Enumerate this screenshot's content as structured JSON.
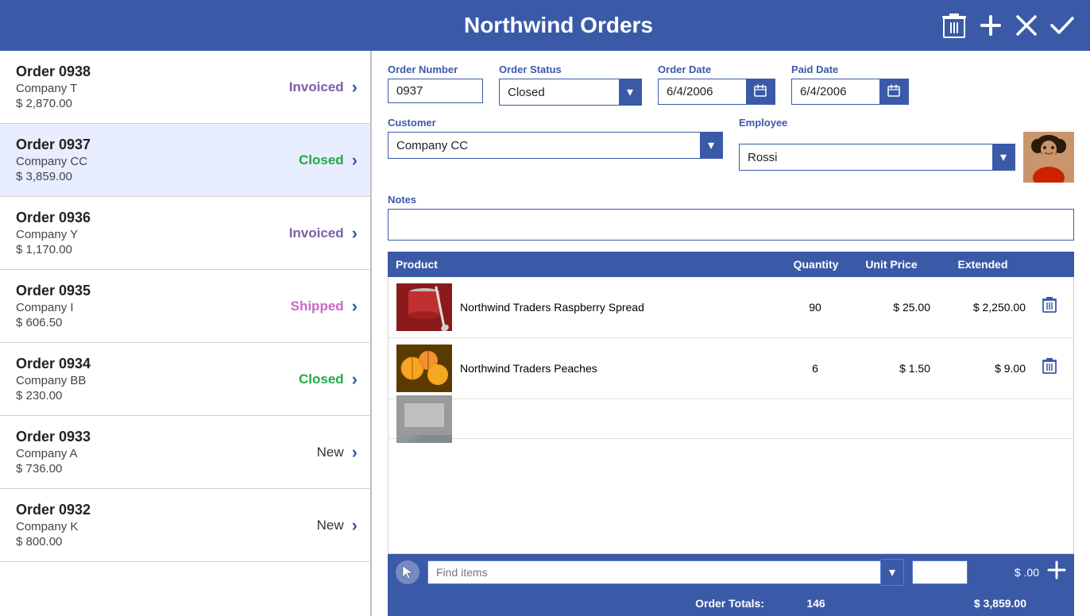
{
  "app": {
    "title": "Northwind Orders"
  },
  "header": {
    "delete_label": "🗑",
    "add_label": "+",
    "cancel_label": "✕",
    "confirm_label": "✓"
  },
  "order_list": {
    "items": [
      {
        "id": "0938",
        "company": "Company T",
        "amount": "$ 2,870.00",
        "status": "Invoiced",
        "status_class": "status-invoiced"
      },
      {
        "id": "0937",
        "company": "Company CC",
        "amount": "$ 3,859.00",
        "status": "Closed",
        "status_class": "status-closed"
      },
      {
        "id": "0936",
        "company": "Company Y",
        "amount": "$ 1,170.00",
        "status": "Invoiced",
        "status_class": "status-invoiced"
      },
      {
        "id": "0935",
        "company": "Company I",
        "amount": "$ 606.50",
        "status": "Shipped",
        "status_class": "status-shipped"
      },
      {
        "id": "0934",
        "company": "Company BB",
        "amount": "$ 230.00",
        "status": "Closed",
        "status_class": "status-closed"
      },
      {
        "id": "0933",
        "company": "Company A",
        "amount": "$ 736.00",
        "status": "New",
        "status_class": "status-new"
      },
      {
        "id": "0932",
        "company": "Company K",
        "amount": "$ 800.00",
        "status": "New",
        "status_class": "status-new"
      }
    ]
  },
  "detail": {
    "order_number_label": "Order Number",
    "order_number_value": "0937",
    "order_status_label": "Order Status",
    "order_status_value": "Closed",
    "order_date_label": "Order Date",
    "order_date_value": "6/4/2006",
    "paid_date_label": "Paid Date",
    "paid_date_value": "6/4/2006",
    "customer_label": "Customer",
    "customer_value": "Company CC",
    "employee_label": "Employee",
    "employee_value": "Rossi",
    "notes_label": "Notes",
    "notes_value": ""
  },
  "products_table": {
    "col_product": "Product",
    "col_quantity": "Quantity",
    "col_unit_price": "Unit Price",
    "col_extended": "Extended",
    "items": [
      {
        "name": "Northwind Traders Raspberry Spread",
        "quantity": "90",
        "unit_price": "$ 25.00",
        "extended": "$ 2,250.00",
        "type": "raspberry"
      },
      {
        "name": "Northwind Traders Peaches",
        "quantity": "6",
        "unit_price": "$ 1.50",
        "extended": "$ 9.00",
        "type": "peaches"
      },
      {
        "name": "",
        "quantity": "",
        "unit_price": "",
        "extended": "",
        "type": "other"
      }
    ]
  },
  "add_item": {
    "find_placeholder": "Find items",
    "qty_value": "",
    "price_display": "$ .00",
    "add_label": "+"
  },
  "totals": {
    "label": "Order Totals:",
    "quantity": "146",
    "amount": "$ 3,859.00"
  }
}
